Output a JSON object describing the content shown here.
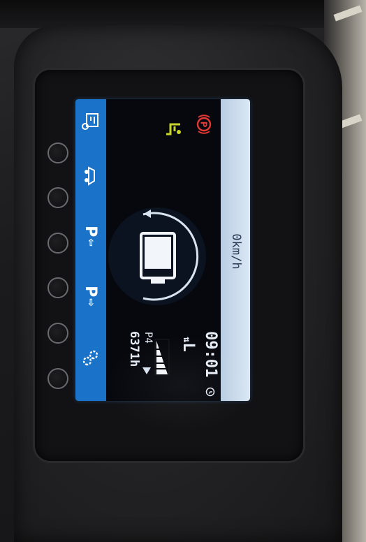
{
  "display": {
    "speed": "0km/h",
    "time": "09:01",
    "lift_mode": "L",
    "profile": "P4",
    "hours": "6371h"
  },
  "menu": {
    "items": [
      {
        "id": "diagnostics",
        "icon": "truck-info-icon",
        "label": ""
      },
      {
        "id": "vehicle",
        "icon": "vehicle-icon",
        "label": ""
      },
      {
        "id": "profile-down",
        "label": "P"
      },
      {
        "id": "profile-up",
        "label": "P"
      },
      {
        "id": "settings",
        "icon": "gears-icon",
        "label": ""
      }
    ]
  },
  "indicators": {
    "park_brake": "P",
    "colors": {
      "park_brake": "#e53935",
      "seat": "#c8d42a",
      "menu_bar": "#1a73c9",
      "speed_bar": "#cfe0f0"
    }
  },
  "battery": {
    "level": 0.85
  }
}
